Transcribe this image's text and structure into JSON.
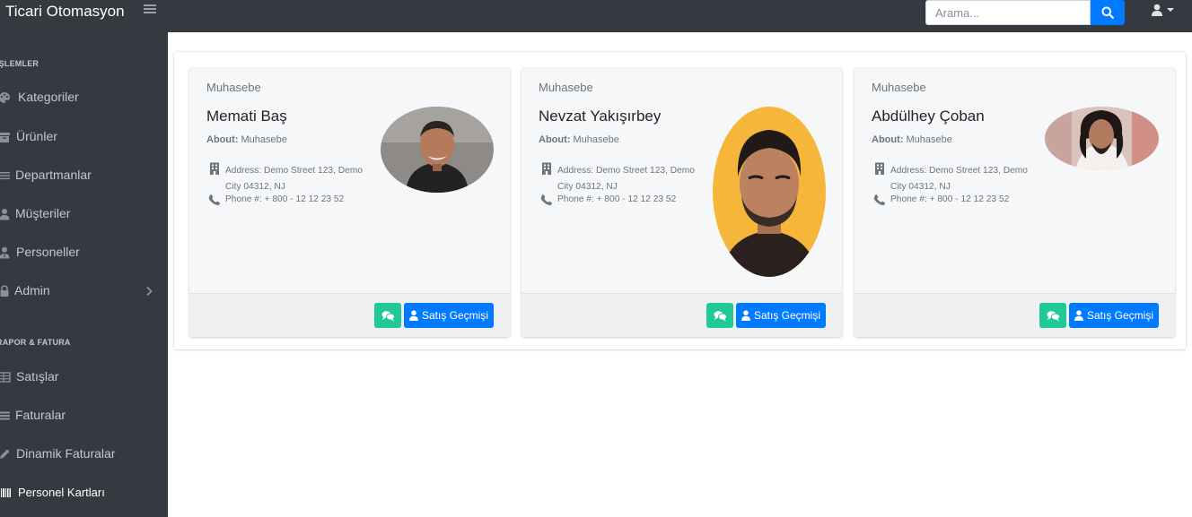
{
  "app": {
    "title": "Ticari Otomasyon"
  },
  "search": {
    "placeholder": "Arama..."
  },
  "sidebar": {
    "sections": [
      {
        "header": "İŞLEMLER"
      },
      {
        "header": "RAPOR & FATURA"
      }
    ],
    "items": [
      {
        "label": "Kategoriler",
        "icon": "palette-icon"
      },
      {
        "label": "Ürünler",
        "icon": "box-icon"
      },
      {
        "label": "Departmanlar",
        "icon": "list-icon"
      },
      {
        "label": "Müşteriler",
        "icon": "user-icon"
      },
      {
        "label": "Personeller",
        "icon": "user-tie-icon"
      },
      {
        "label": "Admin",
        "icon": "lock-icon"
      },
      {
        "label": "Satışlar",
        "icon": "table-icon"
      },
      {
        "label": "Faturalar",
        "icon": "list-icon"
      },
      {
        "label": "Dinamik Faturalar",
        "icon": "pen-icon"
      },
      {
        "label": "Personel Kartları",
        "icon": "barcode-icon"
      }
    ]
  },
  "cards": [
    {
      "department": "Muhasebe",
      "name": "Memati Baş",
      "about_label": "About:",
      "about_value": "Muhasebe",
      "address": "Address: Demo Street 123, Demo City 04312, NJ",
      "phone": "Phone #: + 800 - 12 12 23 52",
      "button_label": "Satış Geçmişi"
    },
    {
      "department": "Muhasebe",
      "name": "Nevzat Yakışırbey",
      "about_label": "About:",
      "about_value": "Muhasebe",
      "address": "Address: Demo Street 123, Demo City 04312, NJ",
      "phone": "Phone #: + 800 - 12 12 23 52",
      "button_label": "Satış Geçmişi"
    },
    {
      "department": "Muhasebe",
      "name": "Abdülhey Çoban",
      "about_label": "About:",
      "about_value": "Muhasebe",
      "address": "Address: Demo Street 123, Demo City 04312, NJ",
      "phone": "Phone #: + 800 - 12 12 23 52",
      "button_label": "Satış Geçmişi"
    }
  ],
  "colors": {
    "sidebar_bg": "#343a40",
    "primary": "#007bff",
    "success": "#20c997"
  }
}
